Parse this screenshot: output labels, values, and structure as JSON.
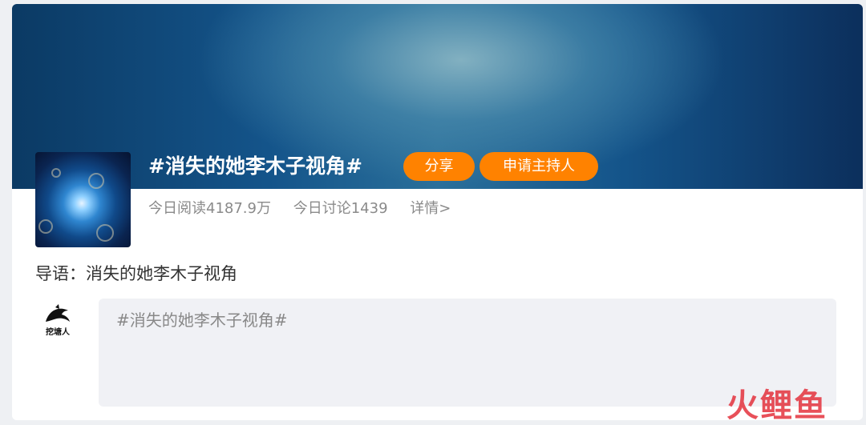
{
  "topic": {
    "title": "#消失的她李木子视角#",
    "share_label": "分享",
    "apply_host_label": "申请主持人",
    "stats": {
      "today_reads": "今日阅读4187.9万",
      "today_discussions": "今日讨论1439",
      "details_link": "详情>"
    },
    "intro": "导语：消失的她李木子视角"
  },
  "post": {
    "avatar_label": "挖塘人",
    "composer_text": "#消失的她李木子视角#"
  },
  "watermark": {
    "text": "火鲤鱼"
  },
  "colors": {
    "accent": "#ff8200",
    "banner_dark": "#0b3a64",
    "banner_light": "#8ab4c4",
    "watermark": "#e4323d"
  },
  "icons": {
    "avatar": "dolphin-logo-icon",
    "cover": "cover-image"
  }
}
